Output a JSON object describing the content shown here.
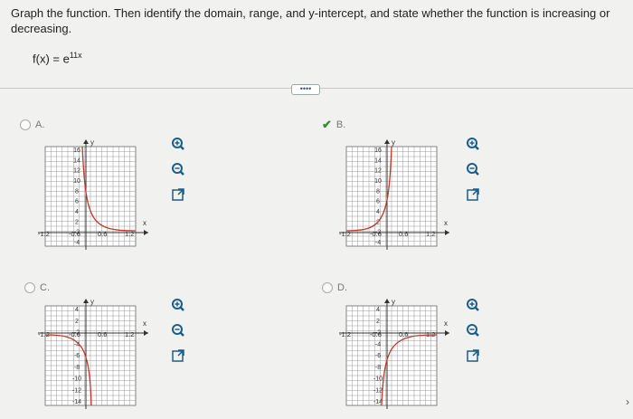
{
  "question": {
    "text": "Graph the function. Then identify the domain, range, and y-intercept, and state whether the function is increasing or decreasing.",
    "function_prefix": "f(x) = e",
    "function_exponent": "11x"
  },
  "more_button": "••••",
  "options": [
    {
      "letter": "A.",
      "selected": false,
      "y_ticks": [
        "16",
        "14",
        "12",
        "10",
        "8",
        "6",
        "4",
        "2",
        "-2",
        "-4"
      ],
      "x_ticks": [
        "-1.2",
        "-0.6",
        "0.6",
        "1.2"
      ],
      "axis_x": "x",
      "axis_y": "y"
    },
    {
      "letter": "B.",
      "selected": true,
      "y_ticks": [
        "16",
        "14",
        "12",
        "10",
        "8",
        "6",
        "4",
        "2",
        "-2",
        "-4"
      ],
      "x_ticks": [
        "-1.2",
        "-0.6",
        "0.6",
        "1.2"
      ],
      "axis_x": "x",
      "axis_y": "y"
    },
    {
      "letter": "C.",
      "selected": false,
      "y_ticks": [
        "4",
        "2",
        "-2",
        "-4",
        "-6",
        "-8",
        "-10",
        "-12",
        "-14"
      ],
      "x_ticks": [
        "-1.2",
        "-0.6",
        "0.6",
        "1.2"
      ],
      "axis_x": "x",
      "axis_y": "y"
    },
    {
      "letter": "D.",
      "selected": false,
      "y_ticks": [
        "4",
        "2",
        "-2",
        "-4",
        "-6",
        "-8",
        "-10",
        "-12",
        "-14"
      ],
      "x_ticks": [
        "-1.2",
        "-0.6",
        "0.6",
        "1.2"
      ],
      "axis_x": "x",
      "axis_y": "y"
    }
  ],
  "colors": {
    "curve": "#c0392b",
    "grid": "#999999",
    "tool": "#1a5f8a",
    "check": "#3a8a3a"
  },
  "icons": [
    "zoom-in-icon",
    "zoom-out-icon",
    "expand-icon"
  ]
}
